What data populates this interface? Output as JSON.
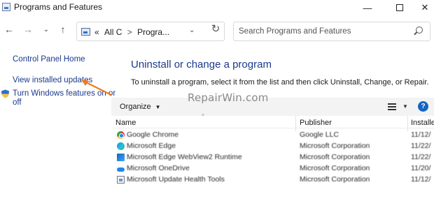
{
  "window": {
    "title": "Programs and Features",
    "minimize_glyph": "—",
    "close_glyph": "✕"
  },
  "nav": {
    "back_glyph": "←",
    "forward_glyph": "→",
    "recent_glyph": "⌄",
    "up_glyph": "↑",
    "refresh_glyph": "↻",
    "address": {
      "prefix": "«",
      "crumb1": "All C",
      "separator": ">",
      "crumb2": "Progra...",
      "dropdown_glyph": "⌄"
    },
    "search_placeholder": "Search Programs and Features"
  },
  "left_pane": {
    "home": "Control Panel Home",
    "updates": "View installed updates",
    "features_line1": "Turn Windows features on or",
    "features_line2": "off"
  },
  "main": {
    "heading": "Uninstall or change a program",
    "description": "To uninstall a program, select it from the list and then click Uninstall, Change, or Repair."
  },
  "toolbar": {
    "organize": "Organize",
    "caret": "▼",
    "views_dd": "▼",
    "help": "?"
  },
  "table": {
    "sort_caret": "^",
    "headers": {
      "name": "Name",
      "publisher": "Publisher",
      "installed": "Installed"
    },
    "rows": [
      {
        "name": "Google Chrome",
        "publisher": "Google LLC",
        "installed": "11/12/"
      },
      {
        "name": "Microsoft Edge",
        "publisher": "Microsoft Corporation",
        "installed": "11/22/"
      },
      {
        "name": "Microsoft Edge WebView2 Runtime",
        "publisher": "Microsoft Corporation",
        "installed": "11/22/"
      },
      {
        "name": "Microsoft OneDrive",
        "publisher": "Microsoft Corporation",
        "installed": "11/20/"
      },
      {
        "name": "Microsoft Update Health Tools",
        "publisher": "Microsoft Corporation",
        "installed": "11/12/"
      }
    ]
  },
  "watermark": "RepairWin.com",
  "colors": {
    "link": "#1a3a8c",
    "arrow": "#f07a1a",
    "toolbar_bg": "#f3f3f3",
    "help": "#1565c0"
  }
}
